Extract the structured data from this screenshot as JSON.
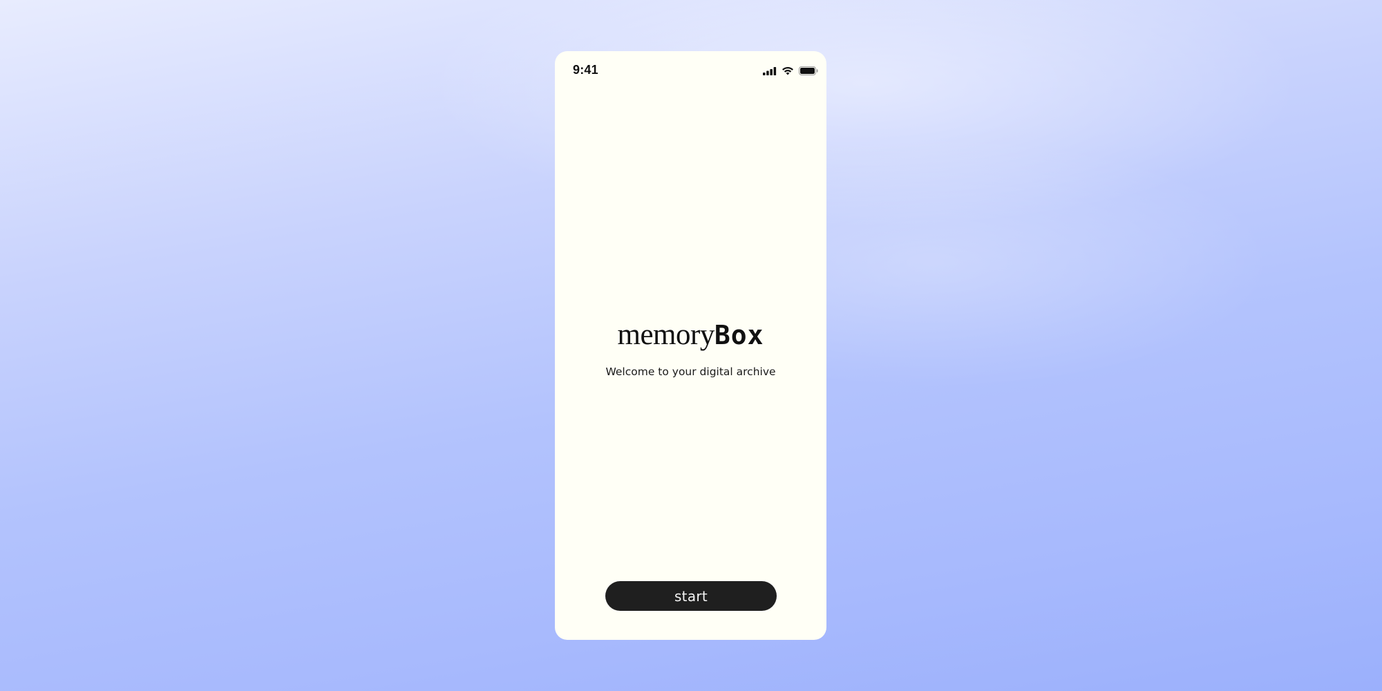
{
  "status_bar": {
    "time": "9:41",
    "icons": [
      "cellular-signal-icon",
      "wifi-icon",
      "battery-icon"
    ]
  },
  "welcome": {
    "brand_part_1": "memory",
    "brand_part_2": "Box",
    "tagline": "Welcome to your digital archive"
  },
  "actions": {
    "start_label": "start"
  },
  "colors": {
    "screen_background": "#fffff6",
    "button_background": "#1f1f1f",
    "button_text": "#f4f4f4",
    "text": "#111111",
    "page_gradient_top": "#e8ecfe",
    "page_gradient_bottom": "#9bb0fc"
  }
}
